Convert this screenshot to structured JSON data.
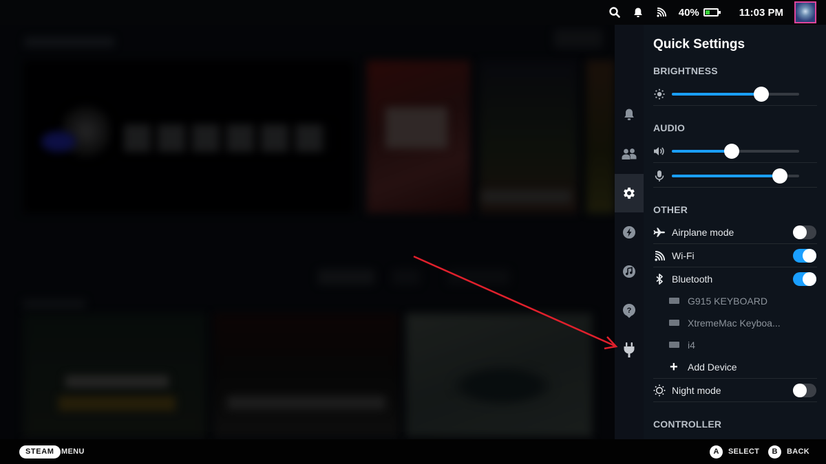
{
  "top_bar": {
    "battery_percent_label": "40%",
    "battery_level": 0.4,
    "time": "11:03 PM",
    "icons": [
      "search-icon",
      "bell-icon",
      "wifi-icon",
      "battery-charging-icon",
      "avatar"
    ]
  },
  "rail": {
    "items": [
      {
        "name": "notifications",
        "icon": "bell-icon"
      },
      {
        "name": "friends",
        "icon": "friends-icon"
      },
      {
        "name": "quick-settings",
        "icon": "gear-icon",
        "active": true
      },
      {
        "name": "performance",
        "icon": "lightning-icon"
      },
      {
        "name": "music",
        "icon": "music-note-icon"
      },
      {
        "name": "help",
        "icon": "help-icon"
      },
      {
        "name": "power",
        "icon": "plug-icon"
      }
    ]
  },
  "quick_settings": {
    "title": "Quick Settings",
    "brightness": {
      "label": "BRIGHTNESS",
      "value": 0.7
    },
    "audio": {
      "label": "AUDIO",
      "volume": 0.47,
      "microphone": 0.85
    },
    "other": {
      "label": "OTHER",
      "airplane_mode": {
        "label": "Airplane mode",
        "on": false
      },
      "wifi": {
        "label": "Wi-Fi",
        "on": true
      },
      "bluetooth": {
        "label": "Bluetooth",
        "on": true
      },
      "devices": [
        "G915 KEYBOARD",
        "XtremeMac Keyboa...",
        "i4"
      ],
      "add_device": "Add Device",
      "night_mode": {
        "label": "Night mode",
        "on": false
      }
    },
    "controller": {
      "label": "CONTROLLER"
    }
  },
  "bottom_bar": {
    "steam": "STEAM",
    "menu": "MENU",
    "a_glyph": "A",
    "select": "SELECT",
    "b_glyph": "B",
    "back": "BACK"
  },
  "colors": {
    "accent": "#1a9fff",
    "panel_bg": "#0e141c",
    "annotation_arrow": "#e0202c"
  }
}
